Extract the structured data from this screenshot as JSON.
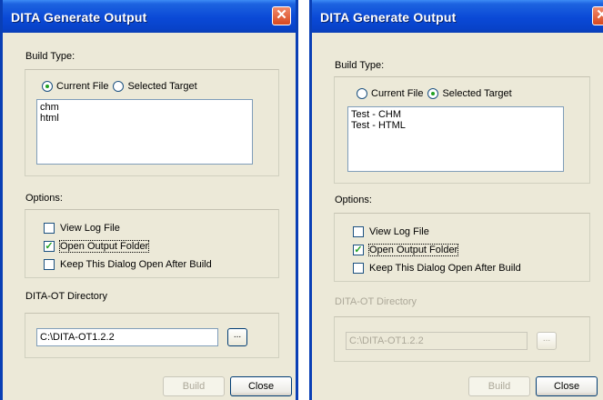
{
  "dialogs": [
    {
      "title": "DITA Generate Output",
      "close_glyph": "✕",
      "build_type_label": "Build Type:",
      "radio_current": "Current File",
      "radio_selected": "Selected Target",
      "selected_option": "Current File",
      "list_items": [
        "chm",
        "html"
      ],
      "options_label": "Options:",
      "opt_view_log": "View Log File",
      "opt_open_output": "Open Output Folder",
      "opt_keep_open": "Keep This Dialog Open After Build",
      "view_log_checked": false,
      "open_output_checked": true,
      "keep_open_checked": false,
      "ditaot_label": "DITA-OT Directory",
      "ditaot_value": "C:\\DITA-OT1.2.2",
      "browse_label": "...",
      "ditaot_enabled": true,
      "build_label": "Build",
      "close_label": "Close"
    },
    {
      "title": "DITA Generate Output",
      "close_glyph": "✕",
      "build_type_label": "Build Type:",
      "radio_current": "Current File",
      "radio_selected": "Selected Target",
      "selected_option": "Selected Target",
      "list_items": [
        "Test - CHM",
        "Test - HTML"
      ],
      "options_label": "Options:",
      "opt_view_log": "View Log File",
      "opt_open_output": "Open Output Folder",
      "opt_keep_open": "Keep This Dialog Open After Build",
      "view_log_checked": false,
      "open_output_checked": true,
      "keep_open_checked": false,
      "ditaot_label": "DITA-OT Directory",
      "ditaot_value": "C:\\DITA-OT1.2.2",
      "browse_label": "...",
      "ditaot_enabled": false,
      "build_label": "Build",
      "close_label": "Close"
    }
  ],
  "colors": {
    "title_blue": "#0a49d6",
    "window_face": "#ece9d8",
    "close_red": "#d8481f",
    "check_green": "#21a121",
    "disabled_text": "#aca899"
  }
}
